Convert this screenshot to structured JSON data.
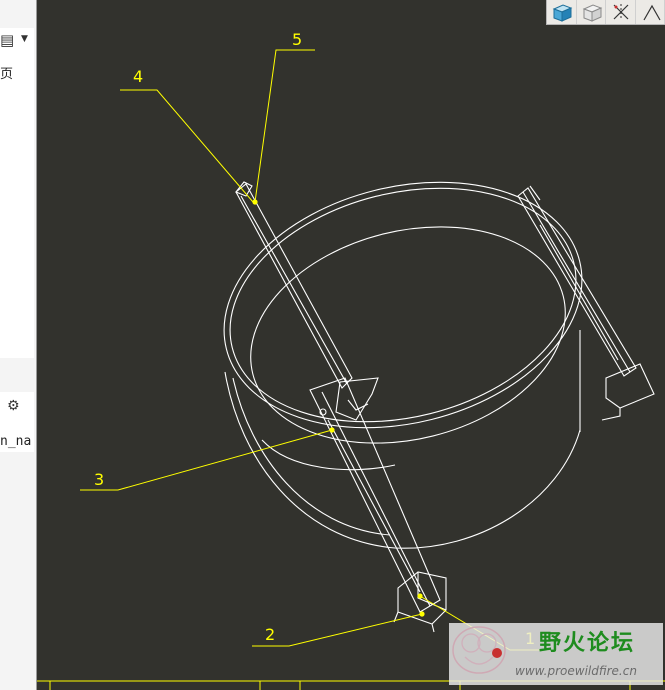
{
  "left_panel": {
    "page_char": "页",
    "name_fragment": "n_na"
  },
  "drawing": {
    "callouts": [
      {
        "label": "5"
      },
      {
        "label": "4"
      },
      {
        "label": "3"
      },
      {
        "label": "2"
      },
      {
        "label": "1"
      }
    ],
    "line_color": "#ffffff",
    "callout_color": "#ffff00",
    "background_color": "#32322d"
  },
  "toolbar": {
    "icons": [
      "shaded-cube-icon",
      "hidden-line-icon",
      "sketch-display-icon",
      "datum-plane-icon"
    ]
  },
  "watermark": {
    "title": "野火论坛",
    "url": "www.proewildfire.cn"
  }
}
